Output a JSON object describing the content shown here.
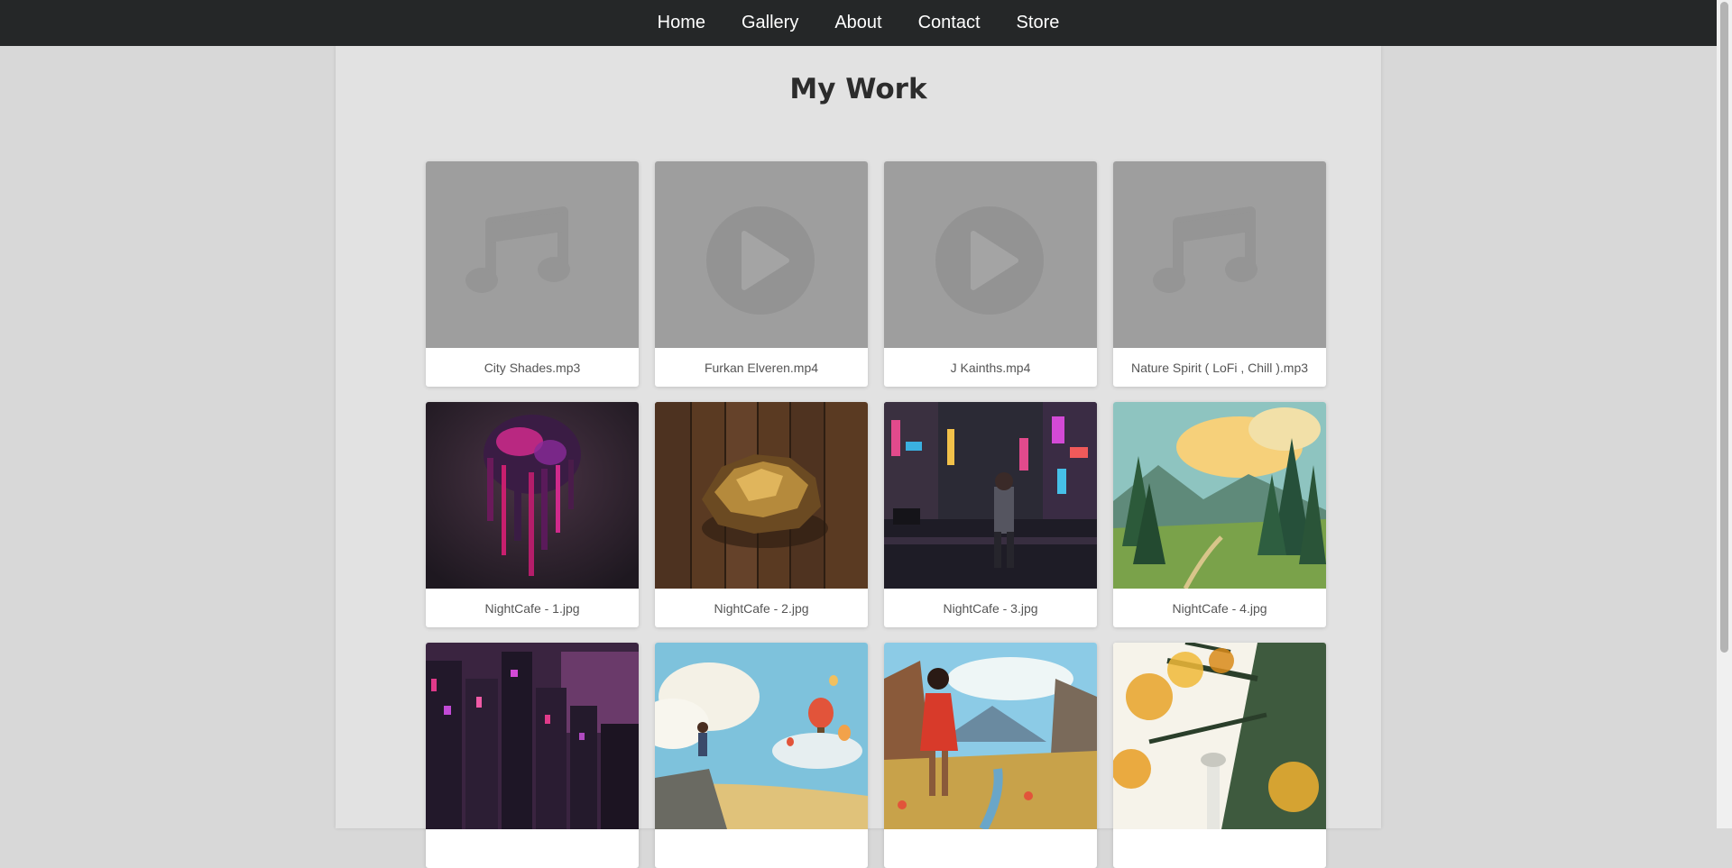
{
  "nav": {
    "items": [
      {
        "label": "Home"
      },
      {
        "label": "Gallery"
      },
      {
        "label": "About"
      },
      {
        "label": "Contact"
      },
      {
        "label": "Store"
      }
    ]
  },
  "page": {
    "title": "My Work"
  },
  "gallery": {
    "items": [
      {
        "caption": "City Shades.mp3",
        "kind": "audio",
        "icon": "music-note-icon"
      },
      {
        "caption": "Furkan Elveren.mp4",
        "kind": "video",
        "icon": "play-icon"
      },
      {
        "caption": "J Kainths.mp4",
        "kind": "video",
        "icon": "play-icon"
      },
      {
        "caption": "Nature Spirit ( LoFi , Chill ).mp3",
        "kind": "audio",
        "icon": "music-note-icon"
      },
      {
        "caption": "NightCafe - 1.jpg",
        "kind": "image"
      },
      {
        "caption": "NightCafe - 2.jpg",
        "kind": "image"
      },
      {
        "caption": "NightCafe - 3.jpg",
        "kind": "image"
      },
      {
        "caption": "NightCafe - 4.jpg",
        "kind": "image"
      },
      {
        "caption": "",
        "kind": "image"
      },
      {
        "caption": "",
        "kind": "image"
      },
      {
        "caption": "",
        "kind": "image"
      },
      {
        "caption": "",
        "kind": "image"
      }
    ]
  },
  "colors": {
    "nav_bg": "#252728",
    "page_bg": "#d8d8d8",
    "content_bg": "#e2e2e2",
    "placeholder_bg": "#9e9e9e"
  }
}
